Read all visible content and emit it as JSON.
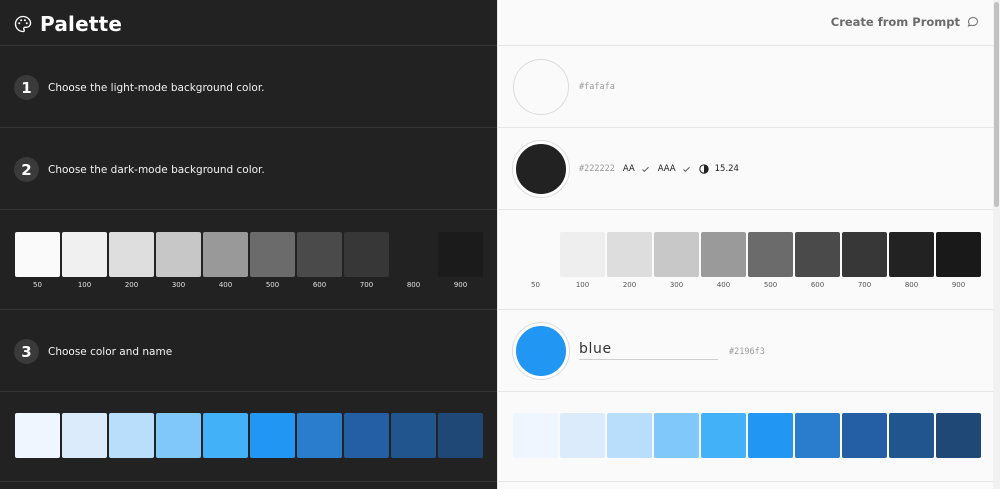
{
  "header": {
    "title": "Palette",
    "prompt_label": "Create from Prompt"
  },
  "steps": [
    {
      "num": "1",
      "text": "Choose the light-mode background color."
    },
    {
      "num": "2",
      "text": "Choose the dark-mode background color."
    },
    {
      "num": "3",
      "text": "Choose color and name"
    }
  ],
  "light": {
    "hex": "#fafafa"
  },
  "dark": {
    "hex": "#222222",
    "aa": "AA",
    "aaa": "AAA",
    "ratio": "15.24"
  },
  "primary": {
    "name": "blue",
    "hex": "#2196f3"
  },
  "gray_labels": [
    "50",
    "100",
    "200",
    "300",
    "400",
    "500",
    "600",
    "700",
    "800",
    "900"
  ],
  "gray_left_colors": [
    "#fafafa",
    "#f0f0f0",
    "#dedede",
    "#c7c7c7",
    "#999999",
    "#6b6b6b",
    "#4a4a4a",
    "#373737",
    "#222222",
    "#1b1b1b"
  ],
  "gray_right_colors": [
    "#fafafa",
    "#eeeeee",
    "#dddddd",
    "#c8c8c8",
    "#9a9a9a",
    "#6b6b6b",
    "#4a4a4a",
    "#373737",
    "#222222",
    "#191919"
  ],
  "blue_colors": [
    "#eff6ff",
    "#dcebfb",
    "#b9defc",
    "#80c8fa",
    "#42b1f8",
    "#2196f3",
    "#2a7ccc",
    "#245fa6",
    "#21558e",
    "#1f4877"
  ],
  "colors": {
    "accent": "#2196f3",
    "dark_bg": "#222222",
    "light_bg": "#fafafa"
  }
}
